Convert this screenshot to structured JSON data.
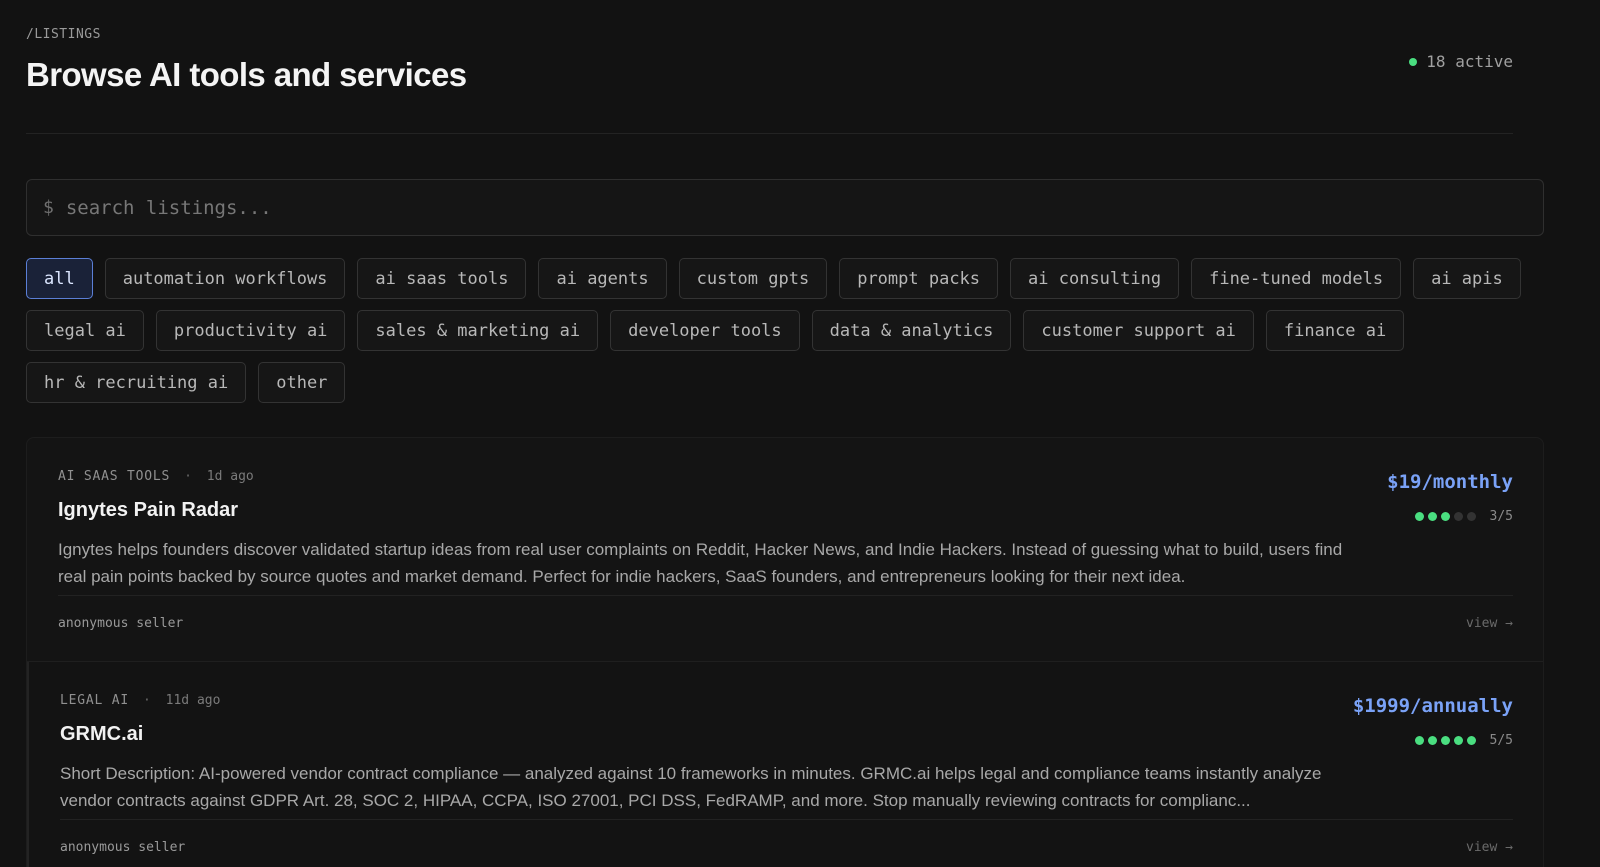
{
  "header": {
    "breadcrumb": "/LISTINGS",
    "title": "Browse AI tools and services",
    "active_count": "18 active"
  },
  "search": {
    "prompt": "$",
    "placeholder": "search listings..."
  },
  "categories": {
    "row1": [
      "all",
      "automation workflows",
      "ai saas tools",
      "ai agents",
      "custom gpts",
      "prompt packs",
      "ai consulting",
      "fine-tuned models",
      "ai apis"
    ],
    "row2": [
      "legal ai",
      "productivity ai",
      "sales & marketing ai",
      "developer tools",
      "data & analytics",
      "customer support ai",
      "finance ai"
    ],
    "row3": [
      "hr & recruiting ai",
      "other"
    ],
    "selected": "all"
  },
  "listings": [
    {
      "category": "AI SAAS TOOLS",
      "separator": "·",
      "time": "1d ago",
      "title": "Ignytes Pain Radar",
      "description": "Ignytes helps founders discover validated startup ideas from real user complaints on Reddit, Hacker News, and Indie Hackers. Instead of guessing what to build, users find real pain points backed by source quotes and market demand. Perfect for indie hackers, SaaS founders, and entrepreneurs looking for their next idea.",
      "price": "$19/monthly",
      "rating": 3,
      "rating_text": "3/5",
      "seller": "anonymous seller",
      "view_label": "view →"
    },
    {
      "category": "LEGAL AI",
      "separator": "·",
      "time": "11d ago",
      "title": "GRMC.ai",
      "description": "Short Description: AI-powered vendor contract compliance — analyzed against 10 frameworks in minutes. GRMC.ai helps legal and compliance teams instantly analyze vendor contracts against GDPR Art. 28, SOC 2, HIPAA, CCPA, ISO 27001, PCI DSS, FedRAMP, and more. Stop manually reviewing contracts for complianc...",
      "price": "$1999/annually",
      "rating": 5,
      "rating_text": "5/5",
      "seller": "anonymous seller",
      "view_label": "view →"
    }
  ],
  "colors": {
    "background": "#121212",
    "accent_price": "#7aa2f7",
    "status_green": "#4ade80",
    "chip_active_border": "#5b7fd6"
  }
}
